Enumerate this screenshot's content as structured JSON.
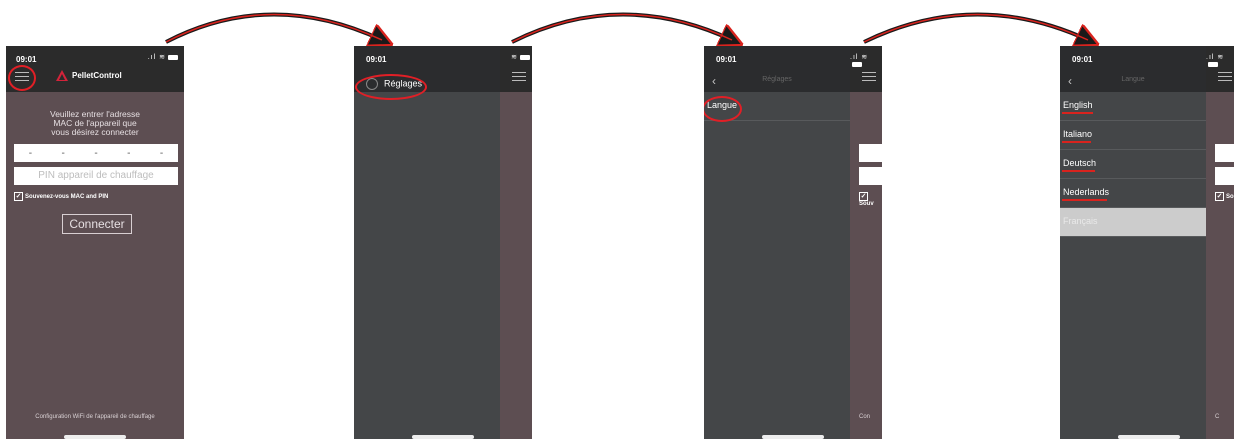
{
  "status_bar": {
    "time": "09:01"
  },
  "screen1": {
    "app_name": "PelletControl",
    "prompt_lines": [
      "Veuillez entrer l'adresse",
      "MAC de l'appareil que",
      "vous désirez connecter"
    ],
    "mac_placeholder_chars": [
      "-",
      "-",
      "-",
      "-",
      "-"
    ],
    "pin_placeholder": "PIN appareil de chauffage",
    "remember_label": "Souvenez-vous MAC and PIN",
    "connect_label": "Connecter",
    "footer_text": "Configuration WiFi de l'appareil de chauffage"
  },
  "screen2": {
    "menu_item": "Réglages"
  },
  "screen3": {
    "title": "Réglages",
    "item": "Langue",
    "strip_check": "Souv",
    "strip_footer": "Con"
  },
  "screen4": {
    "title": "Langue",
    "languages": [
      "English",
      "Italiano",
      "Deutsch",
      "Nederlands",
      "Français"
    ],
    "selected_language": "Français",
    "strip_check": "So",
    "strip_footer": "C"
  },
  "annotation_color": "#e11f26"
}
